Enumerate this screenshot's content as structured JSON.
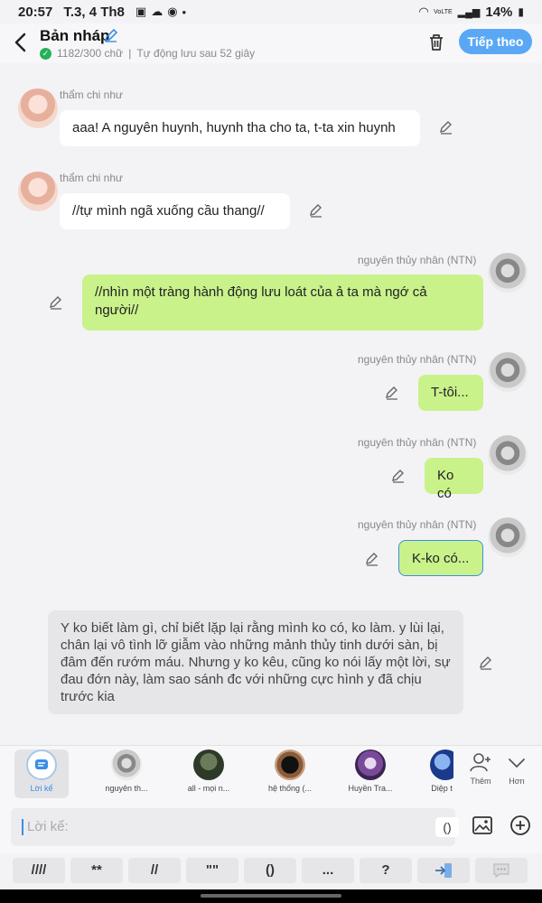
{
  "status_bar": {
    "time": "20:57",
    "date": "T.3, 4 Th8",
    "battery": "14%",
    "network_label": "VoLTE"
  },
  "header": {
    "title": "Bản nháp",
    "word_count": "1182/300 chữ",
    "autosave": "Tự động lưu sau 52 giây",
    "follow_label": "Tiếp theo"
  },
  "messages": [
    {
      "side": "left",
      "sender": "thẩm chi như",
      "text": "aaa! A nguyên huynh, huynh tha cho ta, t-ta xin huynh"
    },
    {
      "side": "left",
      "sender": "thẩm chi như",
      "text": "//tự mình ngã xuống cầu thang//"
    },
    {
      "side": "right",
      "sender": "nguyên thủy nhân (NTN)",
      "text": "//nhìn một tràng hành động lưu loát của ả ta mà ngớ cả người//"
    },
    {
      "side": "right",
      "sender": "nguyên thủy nhân (NTN)",
      "text": "T-tôi..."
    },
    {
      "side": "right",
      "sender": "nguyên thủy nhân (NTN)",
      "text": "Ko có"
    },
    {
      "side": "right",
      "sender": "nguyên thủy nhân (NTN)",
      "text": "K-ko có..."
    }
  ],
  "narration": "Y ko biết làm gì, chỉ biết lặp lại rằng mình ko có, ko làm. y lùi lại, chân lại vô tình lỡ giẫm vào những mảnh thủy tinh dưới sàn, bị đâm đến rướm máu. Nhưng y ko kêu, cũng ko nói lấy một lời, sự đau đớn này, làm sao sánh đc với những cực hình y đã chịu trước kia",
  "characters": [
    {
      "label": "Lời kể",
      "active": true
    },
    {
      "label": "nguyên th...",
      "active": false
    },
    {
      "label": "all - mọi n...",
      "active": false
    },
    {
      "label": "hệ thống (...",
      "active": false
    },
    {
      "label": "Huyền Tra...",
      "active": false
    },
    {
      "label": "Diệp t",
      "active": false
    }
  ],
  "char_actions": {
    "add_label": "Thêm",
    "more_label": "Hơn"
  },
  "composer": {
    "placeholder": "Lời kể:",
    "paren_label": "()"
  },
  "quick_keys": [
    "////",
    "**",
    "//",
    "\"\"",
    "()",
    "...",
    "?"
  ],
  "colors": {
    "accent": "#5aa8f5",
    "right_bubble": "#c9f28b",
    "left_bubble": "#ffffff",
    "narration_bg": "#e6e6e8"
  }
}
